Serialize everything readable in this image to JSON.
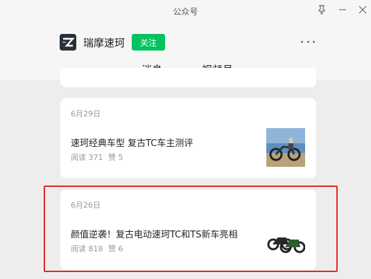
{
  "window": {
    "title": "公众号"
  },
  "account": {
    "name": "瑞摩速珂",
    "follow_label": "关注"
  },
  "tabs": [
    {
      "label": "消息"
    },
    {
      "label": "视频号"
    }
  ],
  "articles": [
    {
      "date": "6月29日",
      "title": "速珂经典车型 复古TC车主测评",
      "reads": "阅读 371",
      "likes": "赞 5"
    },
    {
      "date": "6月26日",
      "title": "颜值逆袭！复古电动速珂TC和TS新车亮相",
      "reads": "阅读 818",
      "likes": "赞 6"
    }
  ],
  "colors": {
    "accent": "#07c160",
    "highlight": "#e02525"
  }
}
